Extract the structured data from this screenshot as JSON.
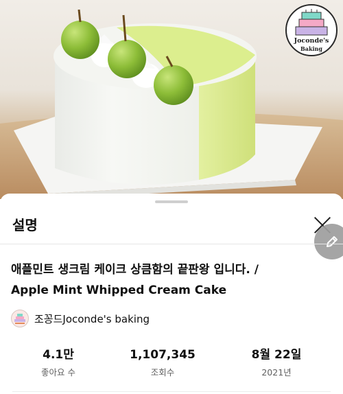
{
  "video": {
    "logo_name": "Joconde's",
    "logo_sub": "Baking"
  },
  "sheet": {
    "title": "설명",
    "video_title_line1": "애플민트 생크림 케이크 상큼함의 끝판왕 입니다. /",
    "video_title_line2": "Apple Mint Whipped Cream Cake",
    "channel_name": "조꽁드Joconde's baking",
    "stats": [
      {
        "value": "4.1만",
        "label": "좋아요 수"
      },
      {
        "value": "1,107,345",
        "label": "조회수"
      },
      {
        "value": "8월 22일",
        "label": "2021년"
      }
    ]
  },
  "colors": {
    "cake_cream": "#f3f4f1",
    "cake_mint": "#d9ec8a",
    "apple_green": "#8fbf3b",
    "table_wood": "#c9a37c"
  }
}
